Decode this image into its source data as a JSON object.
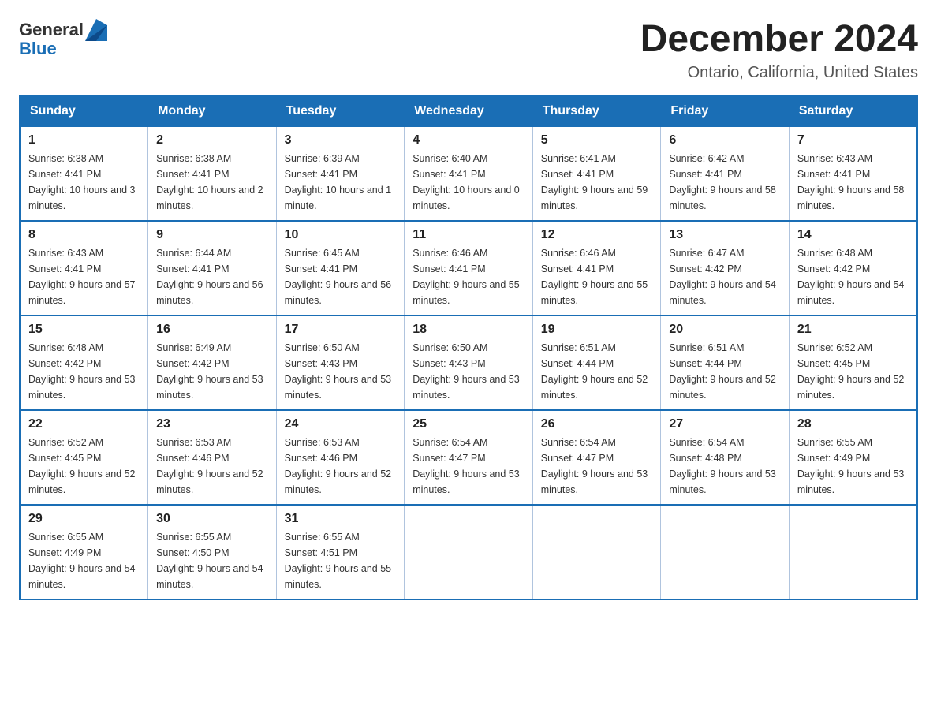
{
  "logo": {
    "text_general": "General",
    "text_blue": "Blue",
    "alt": "GeneralBlue logo"
  },
  "header": {
    "month_year": "December 2024",
    "location": "Ontario, California, United States"
  },
  "weekdays": [
    "Sunday",
    "Monday",
    "Tuesday",
    "Wednesday",
    "Thursday",
    "Friday",
    "Saturday"
  ],
  "weeks": [
    [
      {
        "day": "1",
        "sunrise": "6:38 AM",
        "sunset": "4:41 PM",
        "daylight": "10 hours and 3 minutes."
      },
      {
        "day": "2",
        "sunrise": "6:38 AM",
        "sunset": "4:41 PM",
        "daylight": "10 hours and 2 minutes."
      },
      {
        "day": "3",
        "sunrise": "6:39 AM",
        "sunset": "4:41 PM",
        "daylight": "10 hours and 1 minute."
      },
      {
        "day": "4",
        "sunrise": "6:40 AM",
        "sunset": "4:41 PM",
        "daylight": "10 hours and 0 minutes."
      },
      {
        "day": "5",
        "sunrise": "6:41 AM",
        "sunset": "4:41 PM",
        "daylight": "9 hours and 59 minutes."
      },
      {
        "day": "6",
        "sunrise": "6:42 AM",
        "sunset": "4:41 PM",
        "daylight": "9 hours and 58 minutes."
      },
      {
        "day": "7",
        "sunrise": "6:43 AM",
        "sunset": "4:41 PM",
        "daylight": "9 hours and 58 minutes."
      }
    ],
    [
      {
        "day": "8",
        "sunrise": "6:43 AM",
        "sunset": "4:41 PM",
        "daylight": "9 hours and 57 minutes."
      },
      {
        "day": "9",
        "sunrise": "6:44 AM",
        "sunset": "4:41 PM",
        "daylight": "9 hours and 56 minutes."
      },
      {
        "day": "10",
        "sunrise": "6:45 AM",
        "sunset": "4:41 PM",
        "daylight": "9 hours and 56 minutes."
      },
      {
        "day": "11",
        "sunrise": "6:46 AM",
        "sunset": "4:41 PM",
        "daylight": "9 hours and 55 minutes."
      },
      {
        "day": "12",
        "sunrise": "6:46 AM",
        "sunset": "4:41 PM",
        "daylight": "9 hours and 55 minutes."
      },
      {
        "day": "13",
        "sunrise": "6:47 AM",
        "sunset": "4:42 PM",
        "daylight": "9 hours and 54 minutes."
      },
      {
        "day": "14",
        "sunrise": "6:48 AM",
        "sunset": "4:42 PM",
        "daylight": "9 hours and 54 minutes."
      }
    ],
    [
      {
        "day": "15",
        "sunrise": "6:48 AM",
        "sunset": "4:42 PM",
        "daylight": "9 hours and 53 minutes."
      },
      {
        "day": "16",
        "sunrise": "6:49 AM",
        "sunset": "4:42 PM",
        "daylight": "9 hours and 53 minutes."
      },
      {
        "day": "17",
        "sunrise": "6:50 AM",
        "sunset": "4:43 PM",
        "daylight": "9 hours and 53 minutes."
      },
      {
        "day": "18",
        "sunrise": "6:50 AM",
        "sunset": "4:43 PM",
        "daylight": "9 hours and 53 minutes."
      },
      {
        "day": "19",
        "sunrise": "6:51 AM",
        "sunset": "4:44 PM",
        "daylight": "9 hours and 52 minutes."
      },
      {
        "day": "20",
        "sunrise": "6:51 AM",
        "sunset": "4:44 PM",
        "daylight": "9 hours and 52 minutes."
      },
      {
        "day": "21",
        "sunrise": "6:52 AM",
        "sunset": "4:45 PM",
        "daylight": "9 hours and 52 minutes."
      }
    ],
    [
      {
        "day": "22",
        "sunrise": "6:52 AM",
        "sunset": "4:45 PM",
        "daylight": "9 hours and 52 minutes."
      },
      {
        "day": "23",
        "sunrise": "6:53 AM",
        "sunset": "4:46 PM",
        "daylight": "9 hours and 52 minutes."
      },
      {
        "day": "24",
        "sunrise": "6:53 AM",
        "sunset": "4:46 PM",
        "daylight": "9 hours and 52 minutes."
      },
      {
        "day": "25",
        "sunrise": "6:54 AM",
        "sunset": "4:47 PM",
        "daylight": "9 hours and 53 minutes."
      },
      {
        "day": "26",
        "sunrise": "6:54 AM",
        "sunset": "4:47 PM",
        "daylight": "9 hours and 53 minutes."
      },
      {
        "day": "27",
        "sunrise": "6:54 AM",
        "sunset": "4:48 PM",
        "daylight": "9 hours and 53 minutes."
      },
      {
        "day": "28",
        "sunrise": "6:55 AM",
        "sunset": "4:49 PM",
        "daylight": "9 hours and 53 minutes."
      }
    ],
    [
      {
        "day": "29",
        "sunrise": "6:55 AM",
        "sunset": "4:49 PM",
        "daylight": "9 hours and 54 minutes."
      },
      {
        "day": "30",
        "sunrise": "6:55 AM",
        "sunset": "4:50 PM",
        "daylight": "9 hours and 54 minutes."
      },
      {
        "day": "31",
        "sunrise": "6:55 AM",
        "sunset": "4:51 PM",
        "daylight": "9 hours and 55 minutes."
      },
      null,
      null,
      null,
      null
    ]
  ],
  "labels": {
    "sunrise": "Sunrise:",
    "sunset": "Sunset:",
    "daylight": "Daylight:"
  }
}
